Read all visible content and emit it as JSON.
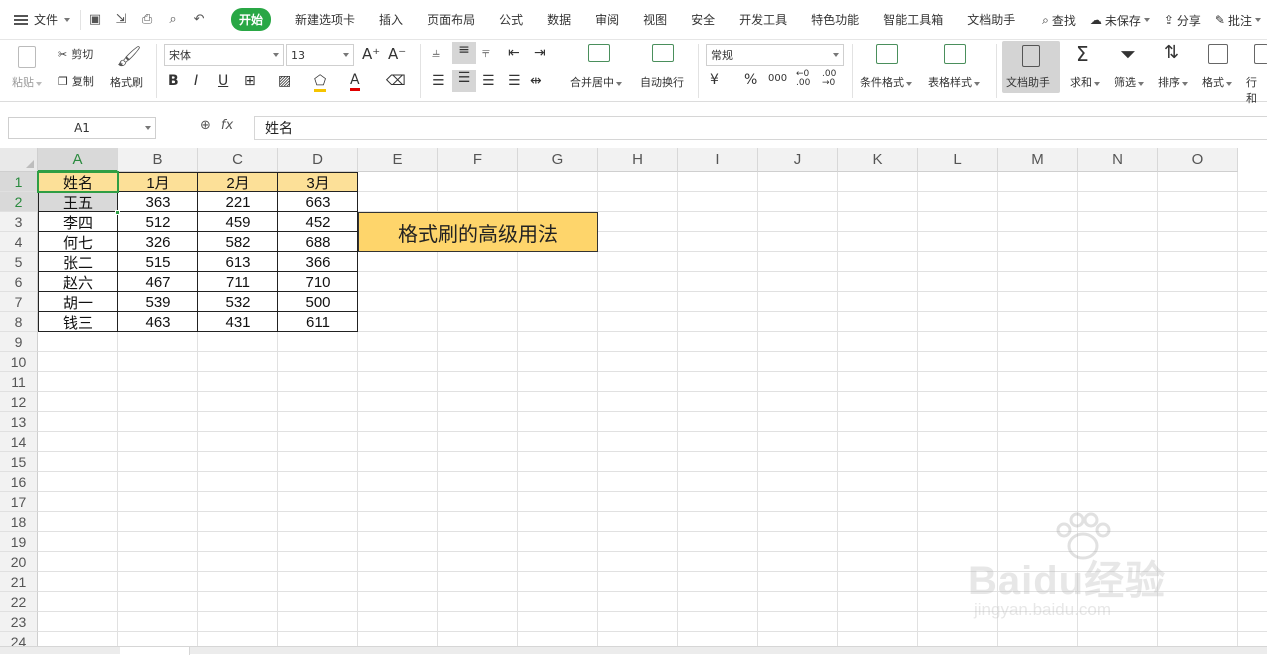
{
  "menu": {
    "file_label": "文件",
    "tabs": [
      "开始",
      "新建选项卡",
      "插入",
      "页面布局",
      "公式",
      "数据",
      "审阅",
      "视图",
      "安全",
      "开发工具",
      "特色功能",
      "智能工具箱",
      "文档助手"
    ],
    "active_tab": "开始",
    "search_label": "查找",
    "unsaved_label": "未保存",
    "share_label": "分享",
    "comment_label": "批注"
  },
  "ribbon": {
    "paste": "粘贴",
    "cut": "剪切",
    "copy": "复制",
    "format_painter": "格式刷",
    "font_name": "宋体",
    "font_size": "13",
    "merge_center": "合并居中",
    "wrap_text": "自动换行",
    "number_format": "常规",
    "conditional_format": "条件格式",
    "table_style": "表格样式",
    "doc_assistant": "文档助手",
    "sum": "求和",
    "filter": "筛选",
    "sort": "排序",
    "format": "格式",
    "rows_cols": "行和"
  },
  "formula_bar": {
    "cell_ref": "A1",
    "fx": "fx",
    "content": "姓名"
  },
  "sheet": {
    "columns": [
      "A",
      "B",
      "C",
      "D",
      "E",
      "F",
      "G",
      "H",
      "I",
      "J",
      "K",
      "L",
      "M",
      "N",
      "O"
    ],
    "rows": [
      "1",
      "2",
      "3",
      "4",
      "5",
      "6",
      "7",
      "8",
      "9",
      "10",
      "11",
      "12",
      "13",
      "14",
      "15",
      "16",
      "17",
      "18",
      "19",
      "20",
      "21",
      "22",
      "23",
      "24"
    ],
    "header": [
      "姓名",
      "1月",
      "2月",
      "3月"
    ],
    "data": [
      [
        "王五",
        "363",
        "221",
        "663"
      ],
      [
        "李四",
        "512",
        "459",
        "452"
      ],
      [
        "何七",
        "326",
        "582",
        "688"
      ],
      [
        "张二",
        "515",
        "613",
        "366"
      ],
      [
        "赵六",
        "467",
        "711",
        "710"
      ],
      [
        "胡一",
        "539",
        "532",
        "500"
      ],
      [
        "钱三",
        "463",
        "431",
        "611"
      ]
    ],
    "note": "格式刷的高级用法",
    "header_fill": "#fce098",
    "note_fill": "#fed56b",
    "selection_color": "#2f9e44"
  },
  "watermark": {
    "brand": "Baidu经验",
    "url": "jingyan.baidu.com"
  }
}
